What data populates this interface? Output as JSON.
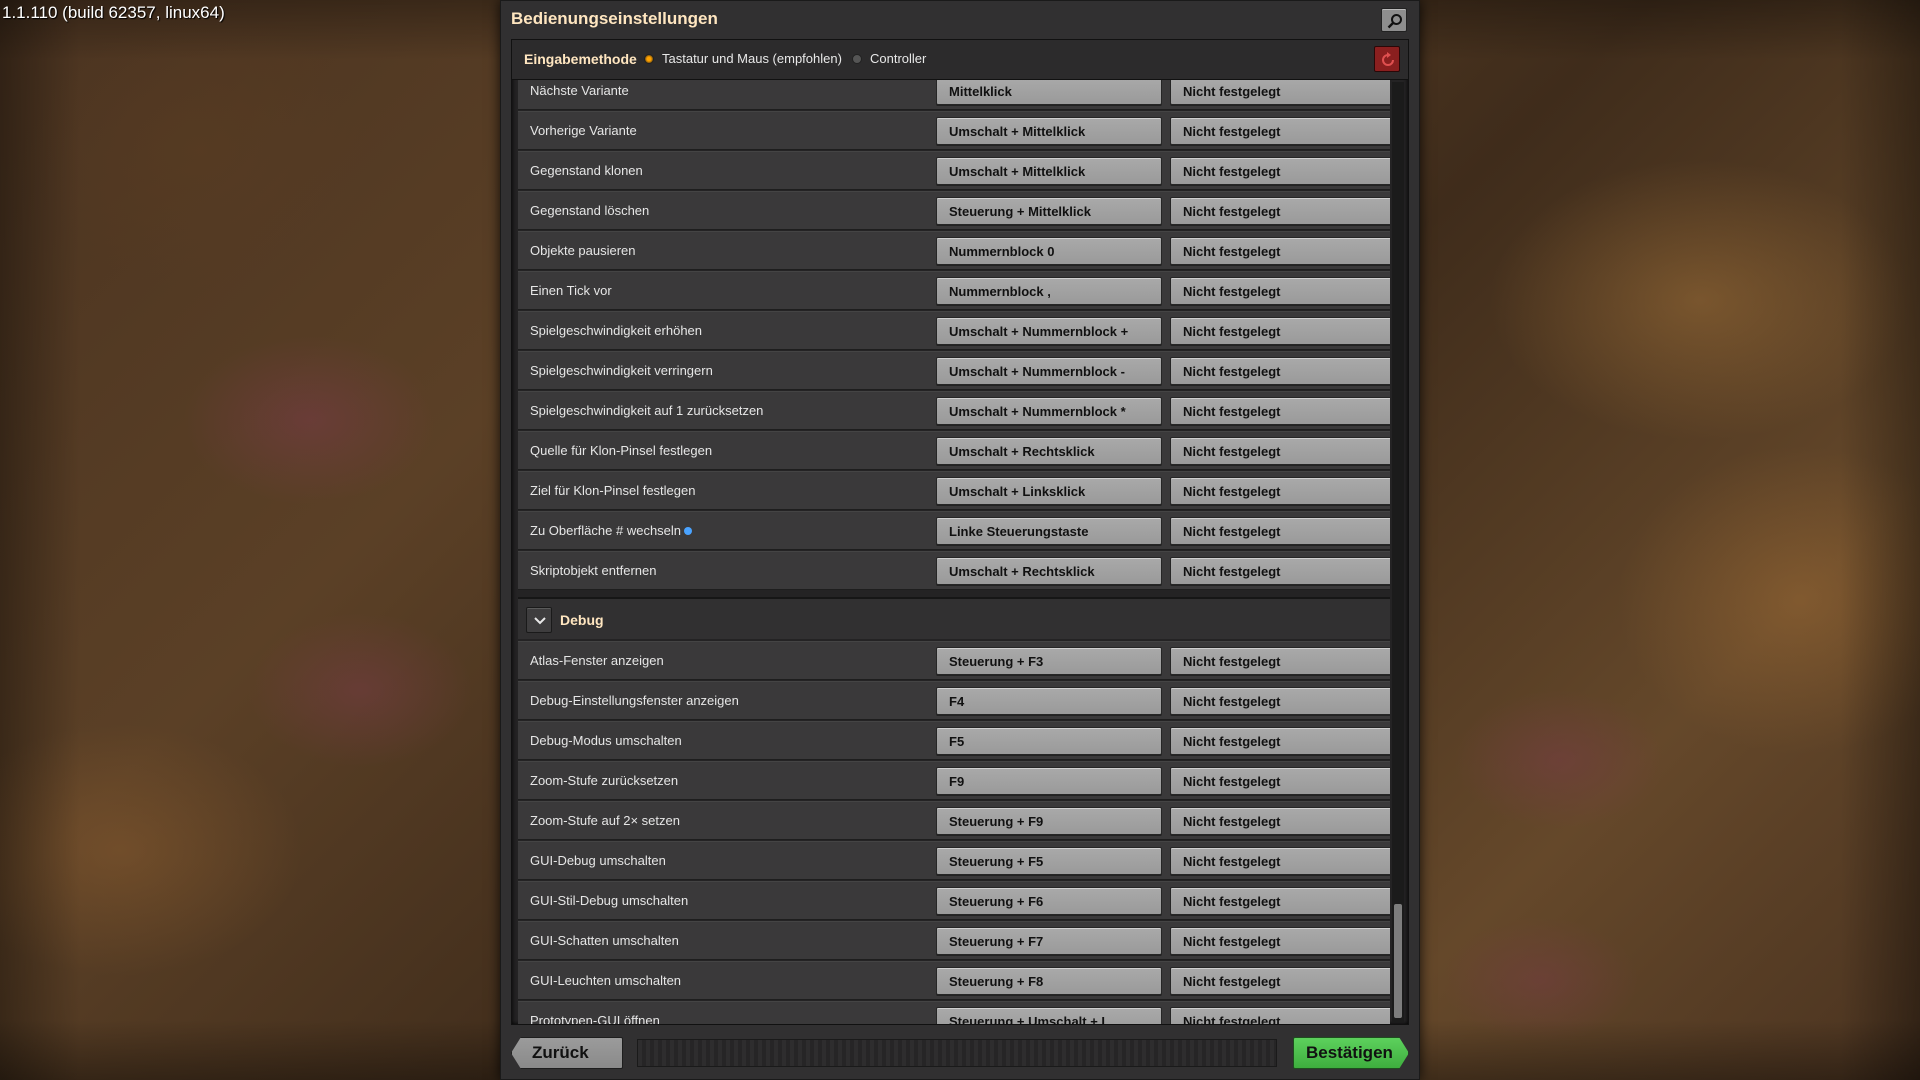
{
  "version": "1.1.110 (build 62357, linux64)",
  "window": {
    "title": "Bedienungseinstellungen"
  },
  "input_method": {
    "label": "Eingabemethode",
    "options": [
      {
        "label": "Tastatur und Maus (empfohlen)",
        "selected": true
      },
      {
        "label": "Controller",
        "selected": false
      }
    ]
  },
  "rows_top": [
    {
      "label": "Nächste Variante",
      "primary": "Mittelklick",
      "secondary": "Nicht festgelegt"
    },
    {
      "label": "Vorherige Variante",
      "primary": "Umschalt + Mittelklick",
      "secondary": "Nicht festgelegt"
    },
    {
      "label": "Gegenstand klonen",
      "primary": "Umschalt + Mittelklick",
      "secondary": "Nicht festgelegt"
    },
    {
      "label": "Gegenstand löschen",
      "primary": "Steuerung + Mittelklick",
      "secondary": "Nicht festgelegt"
    },
    {
      "label": "Objekte pausieren",
      "primary": "Nummernblock 0",
      "secondary": "Nicht festgelegt"
    },
    {
      "label": "Einen Tick vor",
      "primary": "Nummernblock ,",
      "secondary": "Nicht festgelegt"
    },
    {
      "label": "Spielgeschwindigkeit erhöhen",
      "primary": "Umschalt + Nummernblock +",
      "secondary": "Nicht festgelegt"
    },
    {
      "label": "Spielgeschwindigkeit verringern",
      "primary": "Umschalt + Nummernblock -",
      "secondary": "Nicht festgelegt"
    },
    {
      "label": "Spielgeschwindigkeit auf 1 zurücksetzen",
      "primary": "Umschalt + Nummernblock *",
      "secondary": "Nicht festgelegt"
    },
    {
      "label": "Quelle für Klon-Pinsel festlegen",
      "primary": "Umschalt + Rechtsklick",
      "secondary": "Nicht festgelegt"
    },
    {
      "label": "Ziel für Klon-Pinsel festlegen",
      "primary": "Umschalt + Linksklick",
      "secondary": "Nicht festgelegt"
    },
    {
      "label": "Zu Oberfläche # wechseln",
      "primary": "Linke Steuerungstaste",
      "secondary": "Nicht festgelegt",
      "info": true
    },
    {
      "label": "Skriptobjekt entfernen",
      "primary": "Umschalt + Rechtsklick",
      "secondary": "Nicht festgelegt"
    }
  ],
  "debug_section": {
    "title": "Debug",
    "rows": [
      {
        "label": "Atlas-Fenster anzeigen",
        "primary": "Steuerung + F3",
        "secondary": "Nicht festgelegt"
      },
      {
        "label": "Debug-Einstellungsfenster anzeigen",
        "primary": "F4",
        "secondary": "Nicht festgelegt"
      },
      {
        "label": "Debug-Modus umschalten",
        "primary": "F5",
        "secondary": "Nicht festgelegt"
      },
      {
        "label": "Zoom-Stufe zurücksetzen",
        "primary": "F9",
        "secondary": "Nicht festgelegt"
      },
      {
        "label": "Zoom-Stufe auf 2× setzen",
        "primary": "Steuerung + F9",
        "secondary": "Nicht festgelegt"
      },
      {
        "label": "GUI-Debug umschalten",
        "primary": "Steuerung + F5",
        "secondary": "Nicht festgelegt"
      },
      {
        "label": "GUI-Stil-Debug umschalten",
        "primary": "Steuerung + F6",
        "secondary": "Nicht festgelegt"
      },
      {
        "label": "GUI-Schatten umschalten",
        "primary": "Steuerung + F7",
        "secondary": "Nicht festgelegt"
      },
      {
        "label": "GUI-Leuchten umschalten",
        "primary": "Steuerung + F8",
        "secondary": "Nicht festgelegt"
      },
      {
        "label": "Prototypen-GUI öffnen",
        "primary": "Steuerung + Umschalt + I",
        "secondary": "Nicht festgelegt"
      }
    ]
  },
  "footer": {
    "back_label": "Zurück",
    "confirm_label": "Bestätigen"
  },
  "colors": {
    "accent_orange": "#ffa200",
    "confirm_green": "#4ec04e",
    "reset_red": "#8a1f1f",
    "title_text": "#ffe6c0"
  },
  "icons": {
    "search": "search-icon",
    "reset": "reset-icon",
    "collapse": "chevron-down-icon",
    "info": "info-icon"
  }
}
